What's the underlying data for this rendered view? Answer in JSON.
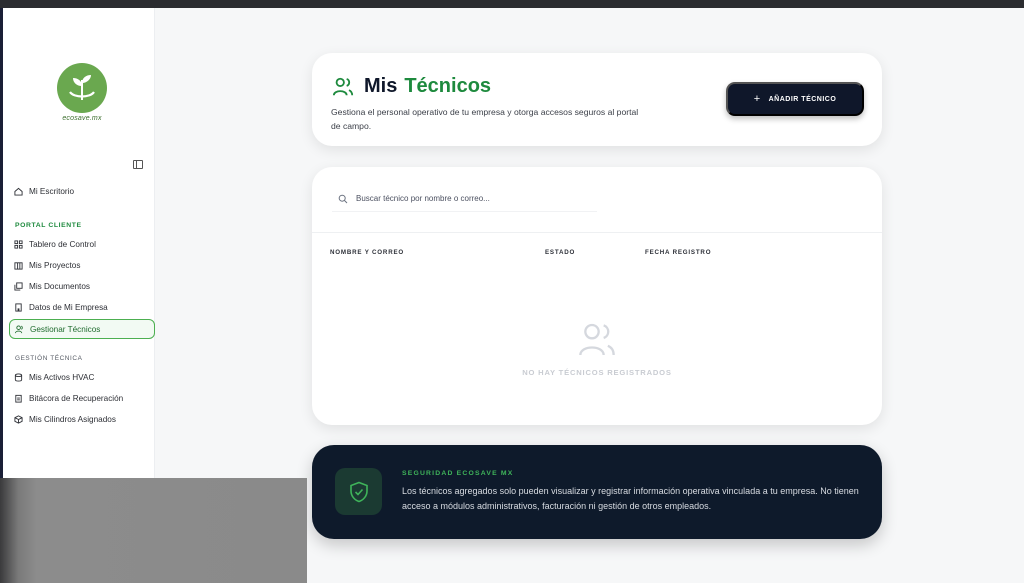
{
  "header": {
    "title_part1": "Mis",
    "title_part2": "Técnicos",
    "description": "Gestiona el personal operativo de tu empresa y otorga accesos seguros al portal de campo.",
    "add_button": "AÑADIR TÉCNICO"
  },
  "sidebar": {
    "logo_text": "ecosave.mx",
    "top_item": "Mi Escritorio",
    "section_portal": "PORTAL CLIENTE",
    "portal_items": [
      "Tablero de Control",
      "Mis Proyectos",
      "Mis Documentos",
      "Datos de Mi Empresa",
      "Gestionar Técnicos"
    ],
    "section_tecnica": "GESTIÓN TÉCNICA",
    "tecnica_items": [
      "Mis Activos HVAC",
      "Bitácora de Recuperación",
      "Mis Cilindros Asignados"
    ]
  },
  "table": {
    "search_placeholder": "Buscar técnico por nombre o correo...",
    "columns": [
      "NOMBRE Y CORREO",
      "ESTADO",
      "FECHA REGISTRO"
    ],
    "empty_message": "NO HAY TÉCNICOS REGISTRADOS"
  },
  "security": {
    "label": "SEGURIDAD ECOSAVE MX",
    "text": "Los técnicos agregados solo pueden visualizar y registrar información operativa vinculada a tu empresa. No tienen acceso a módulos administrativos, facturación ni gestión de otros empleados."
  },
  "colors": {
    "brand_green": "#1e8a3e",
    "navy": "#0f172a",
    "logo_green": "#6aa84f"
  }
}
